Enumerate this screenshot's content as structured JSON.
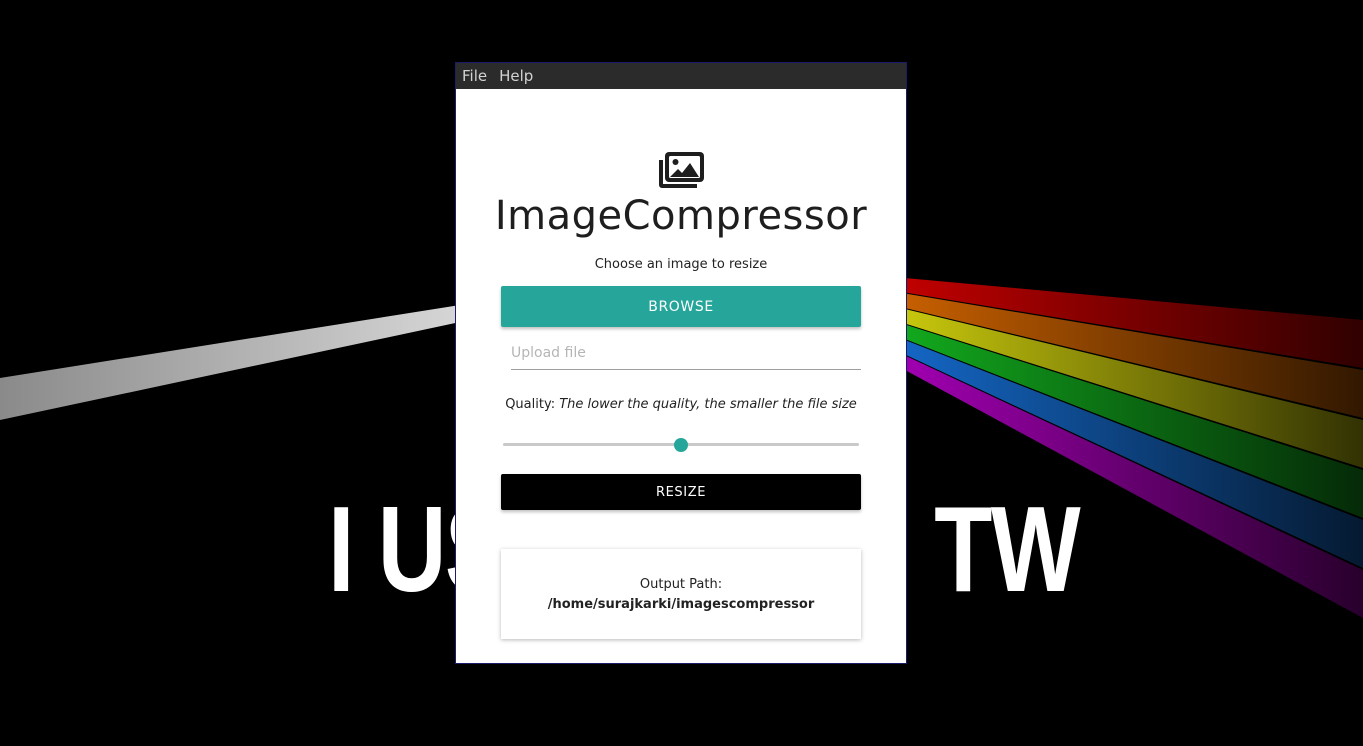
{
  "wallpaper": {
    "text_left": "I US",
    "text_right": "TW",
    "colors": {
      "background": "#000000",
      "beam": "#bdbdbd",
      "spectrum": [
        "#c00000",
        "#c65f00",
        "#c7c70d",
        "#12a81d",
        "#1466c4",
        "#a000b0"
      ]
    }
  },
  "window": {
    "menu": [
      {
        "label": "File"
      },
      {
        "label": "Help"
      }
    ],
    "logo_icon": "photo-library-icon",
    "title": "ImageCompressor",
    "subtitle": "Choose an image to resize",
    "browse_label": "BROWSE",
    "upload": {
      "placeholder": "Upload file",
      "value": ""
    },
    "quality": {
      "label": "Quality:",
      "hint": "The lower the quality, the smaller the file size",
      "value": 0.5
    },
    "resize_label": "RESIZE",
    "output": {
      "label": "Output Path:",
      "path": "/home/surajkarki/imagescompressor"
    },
    "colors": {
      "accent": "#26a69a",
      "menubar": "#2b2b2b",
      "primary_button": "#000000"
    }
  }
}
